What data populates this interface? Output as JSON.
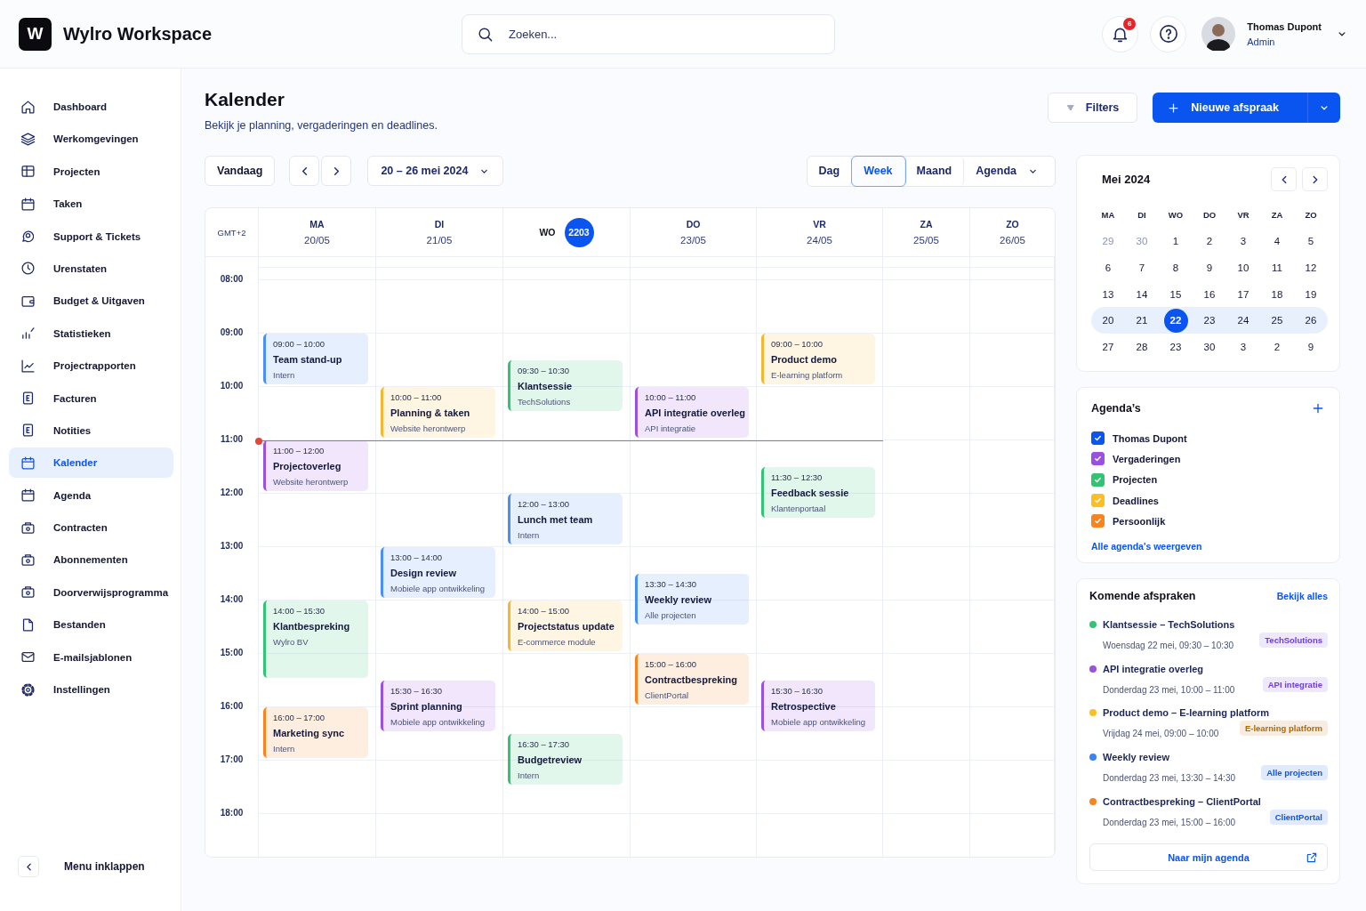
{
  "header": {
    "logo_letter": "W",
    "app_name": "Wylro Workspace",
    "search": {
      "placeholder": "Zoeken..."
    },
    "notifications": {
      "count": "6"
    },
    "user": {
      "name": "Thomas Dupont",
      "role": "Admin"
    }
  },
  "sidebar": {
    "items": [
      {
        "label": "Dashboard",
        "selected": false
      },
      {
        "label": "Werkomgevingen",
        "selected": false
      },
      {
        "label": "Projecten",
        "selected": false
      },
      {
        "label": "Taken",
        "selected": false
      },
      {
        "label": "Support & Tickets",
        "selected": false
      },
      {
        "label": "Urenstaten",
        "selected": false
      },
      {
        "label": "Budget & Uitgaven",
        "selected": false
      },
      {
        "label": "Statistieken",
        "selected": false
      },
      {
        "label": "Projectrapporten",
        "selected": false
      },
      {
        "label": "Facturen",
        "selected": false
      },
      {
        "label": "Notities",
        "selected": false
      },
      {
        "label": "Kalender",
        "selected": true
      },
      {
        "label": "Agenda",
        "selected": false
      },
      {
        "label": "Contracten",
        "selected": false
      },
      {
        "label": "Abonnementen",
        "selected": false
      },
      {
        "label": "Doorverwijsprogramma",
        "selected": false
      },
      {
        "label": "Bestanden",
        "selected": false
      },
      {
        "label": "E-mailsjablonen",
        "selected": false
      },
      {
        "label": "Instellingen",
        "selected": false
      }
    ],
    "collapse_label": "Menu inklappen"
  },
  "page": {
    "title": "Kalender",
    "subtitle": "Bekijk je planning, vergaderingen en deadlines.",
    "filters_button": "Filters",
    "new_button": "Nieuwe afspraak"
  },
  "toolbar": {
    "today_button": "Vandaag",
    "date_range": "20 – 26 mei 2024",
    "views": [
      {
        "label": "Dag",
        "selected": false
      },
      {
        "label": "Week",
        "selected": true
      },
      {
        "label": "Maand",
        "selected": false
      },
      {
        "label": "Agenda",
        "selected": false
      }
    ]
  },
  "calendar": {
    "timezone": "GMT+2",
    "hours": [
      "08:00",
      "09:00",
      "10:00",
      "11:00",
      "12:00",
      "13:00",
      "14:00",
      "15:00",
      "16:00",
      "17:00",
      "18:00"
    ],
    "days": [
      {
        "day": "MA",
        "date": "20/05",
        "today": false,
        "events": [
          {
            "time": "09:00 – 10:00",
            "title": "Team stand-up",
            "subtitle": "Intern",
            "color": "#4a8ff5"
          },
          {
            "time": "11:00 – 12:00",
            "title": "Projectoverleg",
            "subtitle": "Website herontwerp",
            "color": "#9b51e0"
          },
          {
            "time": "14:00 – 15:30",
            "title": "Klantbespreking",
            "subtitle": "Wylro BV",
            "color": "#34c375"
          },
          {
            "time": "16:00 – 17:00",
            "title": "Marketing sync",
            "subtitle": "Intern",
            "color": "#f7841e"
          }
        ]
      },
      {
        "day": "DI",
        "date": "21/05",
        "today": false,
        "events": [
          {
            "time": "10:00 – 11:00",
            "title": "Planning & taken",
            "subtitle": "Website herontwerp",
            "color": "#f5b731"
          },
          {
            "time": "13:00 – 14:00",
            "title": "Design review",
            "subtitle": "Mobiele app ontwikkeling",
            "color": "#4a8ff5"
          },
          {
            "time": "15:30 – 16:30",
            "title": "Sprint planning",
            "subtitle": "Mobiele app ontwikkeling",
            "color": "#9b51e0"
          }
        ]
      },
      {
        "day": "WO",
        "date": "2203",
        "today": true,
        "events": [
          {
            "time": "09:30 – 10:30",
            "title": "Klantsessie",
            "subtitle": "TechSolutions",
            "color": "#34c375"
          },
          {
            "time": "12:00 – 13:00",
            "title": "Lunch met team",
            "subtitle": "Intern",
            "color": "#4a8ff5"
          },
          {
            "time": "14:00 – 15:00",
            "title": "Projectstatus update",
            "subtitle": "E-commerce module",
            "color": "#f5b731"
          },
          {
            "time": "16:30 – 17:30",
            "title": "Budgetreview",
            "subtitle": "Intern",
            "color": "#34c375"
          }
        ]
      },
      {
        "day": "DO",
        "date": "23/05",
        "today": false,
        "events": [
          {
            "time": "10:00 – 11:00",
            "title": "API integratie overleg",
            "subtitle": "API integratie",
            "color": "#9b51e0"
          },
          {
            "time": "13:30 – 14:30",
            "title": "Weekly review",
            "subtitle": "Alle projecten",
            "color": "#4a8ff5"
          },
          {
            "time": "15:00 – 16:00",
            "title": "Contractbespreking",
            "subtitle": "ClientPortal",
            "color": "#f7841e"
          }
        ]
      },
      {
        "day": "VR",
        "date": "24/05",
        "today": false,
        "events": [
          {
            "time": "09:00 – 10:00",
            "title": "Product demo",
            "subtitle": "E-learning platform",
            "color": "#f5b731"
          },
          {
            "time": "11:30 – 12:30",
            "title": "Feedback sessie",
            "subtitle": "Klantenportaal",
            "color": "#34c375"
          },
          {
            "time": "15:30 – 16:30",
            "title": "Retrospective",
            "subtitle": "Mobiele app ontwikkeling",
            "color": "#9b51e0"
          }
        ]
      },
      {
        "day": "ZA",
        "date": "25/05",
        "today": false
      },
      {
        "day": "ZO",
        "date": "26/05",
        "today": false
      }
    ]
  },
  "mini_calendar": {
    "month": "Mei 2024",
    "weekdays": [
      "MA",
      "DI",
      "WO",
      "DO",
      "VR",
      "ZA",
      "ZO"
    ],
    "weeks": [
      {
        "selected": false,
        "days": [
          {
            "text": "29",
            "muted": true,
            "selected": false
          },
          {
            "text": "30",
            "muted": true,
            "selected": false
          },
          {
            "text": "1",
            "muted": false,
            "selected": false
          },
          {
            "text": "2",
            "muted": false,
            "selected": false
          },
          {
            "text": "3",
            "muted": false,
            "selected": false
          },
          {
            "text": "4",
            "muted": false,
            "selected": false
          },
          {
            "text": "5",
            "muted": false,
            "selected": false
          }
        ]
      },
      {
        "selected": false,
        "days": [
          {
            "text": "6",
            "muted": false,
            "selected": false
          },
          {
            "text": "7",
            "muted": false,
            "selected": false
          },
          {
            "text": "8",
            "muted": false,
            "selected": false
          },
          {
            "text": "9",
            "muted": false,
            "selected": false
          },
          {
            "text": "10",
            "muted": false,
            "selected": false
          },
          {
            "text": "11",
            "muted": false,
            "selected": false
          },
          {
            "text": "12",
            "muted": false,
            "selected": false
          }
        ]
      },
      {
        "selected": false,
        "days": [
          {
            "text": "13",
            "muted": false,
            "selected": false
          },
          {
            "text": "14",
            "muted": false,
            "selected": false
          },
          {
            "text": "15",
            "muted": false,
            "selected": false
          },
          {
            "text": "16",
            "muted": false,
            "selected": false
          },
          {
            "text": "17",
            "muted": false,
            "selected": false
          },
          {
            "text": "18",
            "muted": false,
            "selected": false
          },
          {
            "text": "19",
            "muted": false,
            "selected": false
          }
        ]
      },
      {
        "selected": true,
        "days": [
          {
            "text": "20",
            "muted": false,
            "selected": false
          },
          {
            "text": "21",
            "muted": false,
            "selected": false
          },
          {
            "text": "22",
            "muted": false,
            "selected": true
          },
          {
            "text": "23",
            "muted": false,
            "selected": false
          },
          {
            "text": "24",
            "muted": false,
            "selected": false
          },
          {
            "text": "25",
            "muted": false,
            "selected": false
          },
          {
            "text": "26",
            "muted": false,
            "selected": false
          }
        ]
      },
      {
        "selected": false,
        "days": [
          {
            "text": "27",
            "muted": false,
            "selected": false
          },
          {
            "text": "28",
            "muted": false,
            "selected": false
          },
          {
            "text": "23",
            "muted": false,
            "selected": false
          },
          {
            "text": "30",
            "muted": false,
            "selected": false
          },
          {
            "text": "3",
            "muted": false,
            "selected": false
          },
          {
            "text": "2",
            "muted": false,
            "selected": false
          },
          {
            "text": "9",
            "muted": false,
            "selected": false
          }
        ]
      }
    ]
  },
  "agendas": {
    "title": "Agenda’s",
    "items": [
      {
        "label": "Thomas Dupont",
        "checked": true,
        "color": "#0a55f0"
      },
      {
        "label": "Vergaderingen",
        "checked": true,
        "color": "#9b51e0"
      },
      {
        "label": "Projecten",
        "checked": true,
        "color": "#34c375"
      },
      {
        "label": "Deadlines",
        "checked": true,
        "color": "#fbbf24"
      },
      {
        "label": "Persoonlijk",
        "checked": true,
        "color": "#f7841e"
      }
    ],
    "link": "Alle agenda's weergeven"
  },
  "upcoming": {
    "title": "Komende afspraken",
    "link": "Bekijk alles",
    "items": [
      {
        "title": "Klantsessie – TechSolutions",
        "when": "Woensdag 22 mei, 09:30 – 10:30",
        "tag": {
          "text": "TechSolutions",
          "color": "#6d3fd6"
        },
        "color": "#34c375"
      },
      {
        "title": "API integratie overleg",
        "when": "Donderdag 23 mei, 10:00 – 11:00",
        "tag": {
          "text": "API integratie",
          "color": "#6d3fd6"
        },
        "color": "#9b51e0"
      },
      {
        "title": "Product demo – E-learning platform",
        "when": "Vrijdag 24 mei, 09:00 – 10:00",
        "tag": {
          "text": "E-learning platform",
          "color": "#b26a00"
        },
        "color": "#fbbf24"
      },
      {
        "title": "Weekly review",
        "when": "Donderdag 23 mei, 13:30 – 14:30",
        "tag": {
          "text": "Alle projecten",
          "color": "#0a55f0"
        },
        "color": "#3b82f6"
      },
      {
        "title": "Contractbespreking – ClientPortal",
        "when": "Donderdag 23 mei, 15:00 – 16:00",
        "tag": {
          "text": "ClientPortal",
          "color": "#0a55f0"
        },
        "color": "#f7841e"
      }
    ],
    "button": "Naar mijn agenda"
  }
}
